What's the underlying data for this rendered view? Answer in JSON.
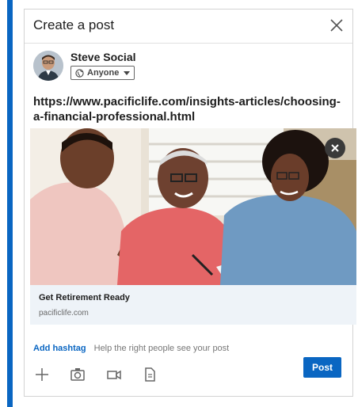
{
  "modal": {
    "title": "Create a post"
  },
  "author": {
    "name": "Steve Social",
    "visibility": "Anyone"
  },
  "post": {
    "text": "https://www.pacificlife.com/insights-articles/choosing-a-financial-professional.html"
  },
  "link_preview": {
    "title": "Get Retirement Ready",
    "domain": "pacificlife.com"
  },
  "hashtag": {
    "label": "Add hashtag",
    "hint": "Help the right people see your post"
  },
  "toolbar": {
    "icons": [
      "plus-icon",
      "camera-icon",
      "video-icon",
      "document-icon"
    ],
    "post_label": "Post"
  },
  "colors": {
    "accent": "#0a66c2",
    "card_bg": "#eef3f8"
  }
}
